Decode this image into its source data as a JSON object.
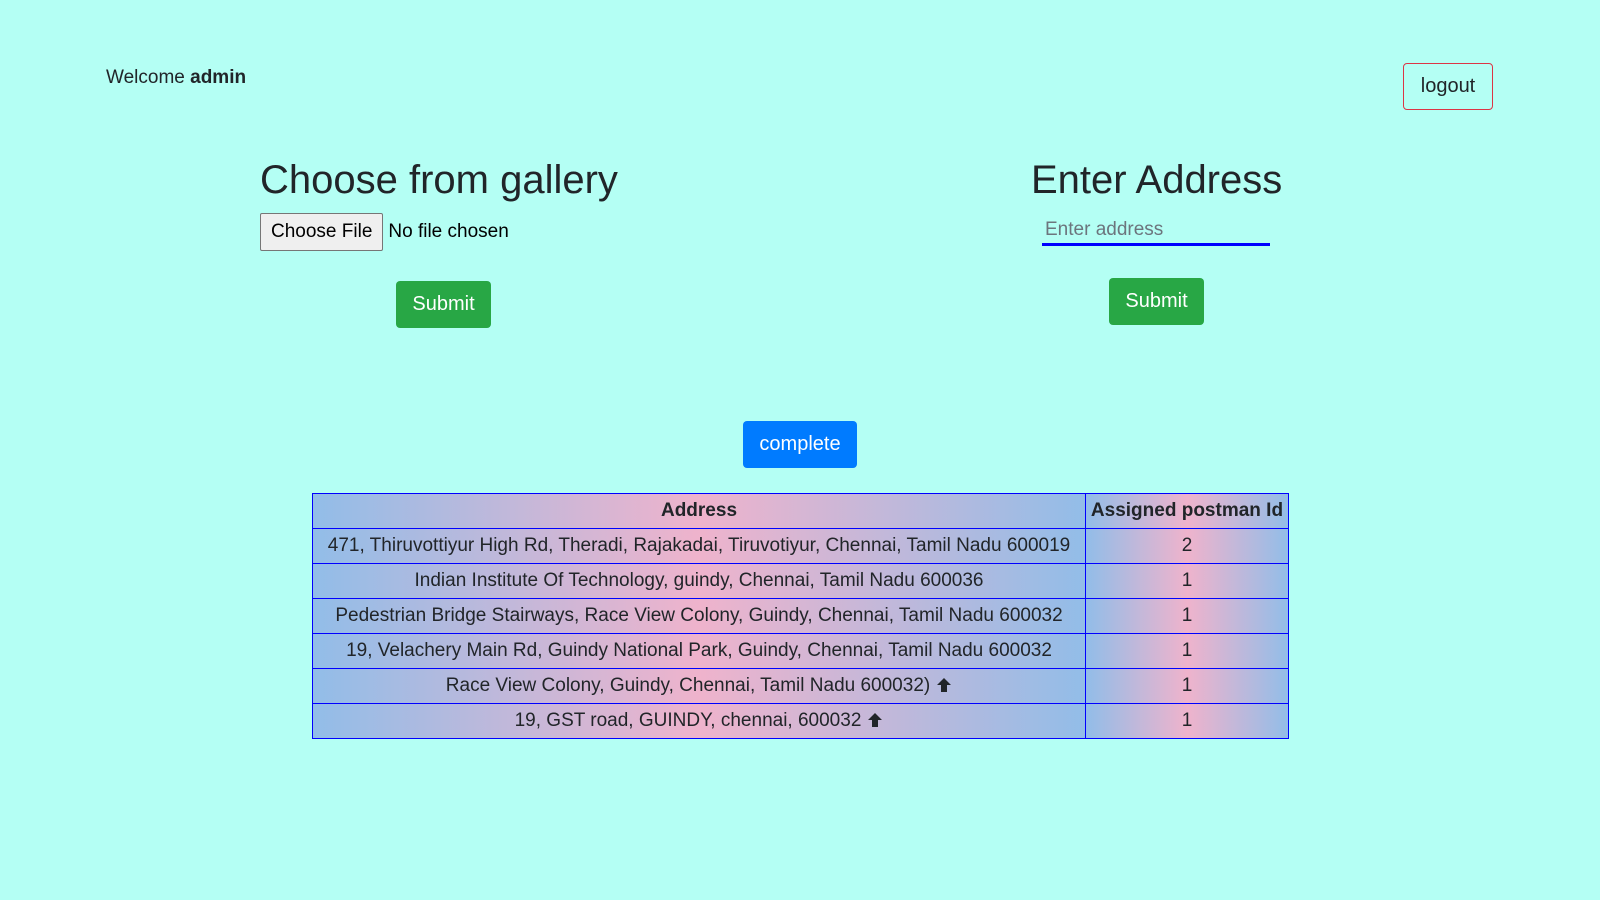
{
  "header": {
    "welcome_prefix": "Welcome",
    "username": "admin",
    "logout_label": "logout"
  },
  "gallery": {
    "title": "Choose from gallery",
    "choose_file_label": "Choose File",
    "file_status": "No file chosen",
    "submit_label": "Submit"
  },
  "address_form": {
    "title": "Enter Address",
    "input_value": "",
    "input_placeholder": "Enter address",
    "submit_label": "Submit"
  },
  "complete_label": "complete",
  "table": {
    "headers": [
      "Address",
      "Assigned postman Id"
    ],
    "rows": [
      {
        "address": "471, Thiruvottiyur High Rd, Theradi, Rajakadai, Tiruvotiyur, Chennai, Tamil Nadu 600019",
        "postman_id": "2",
        "icon": ""
      },
      {
        "address": "Indian Institute Of Technology, guindy, Chennai, Tamil Nadu 600036",
        "postman_id": "1",
        "icon": ""
      },
      {
        "address": "Pedestrian Bridge Stairways, Race View Colony, Guindy, Chennai, Tamil Nadu 600032",
        "postman_id": "1",
        "icon": ""
      },
      {
        "address": "19, Velachery Main Rd, Guindy National Park, Guindy, Chennai, Tamil Nadu 600032",
        "postman_id": "1",
        "icon": ""
      },
      {
        "address": "Race View Colony, Guindy, Chennai, Tamil Nadu 600032)",
        "postman_id": "1",
        "icon": "up-arrow-icon"
      },
      {
        "address": "19, GST road, GUINDY, chennai, 600032",
        "postman_id": "1",
        "icon": "up-arrow-icon"
      }
    ]
  },
  "colors": {
    "background": "#b4fff4",
    "success": "#28a745",
    "primary": "#007bff",
    "danger": "#dc3545",
    "table_border": "#0000ff"
  }
}
